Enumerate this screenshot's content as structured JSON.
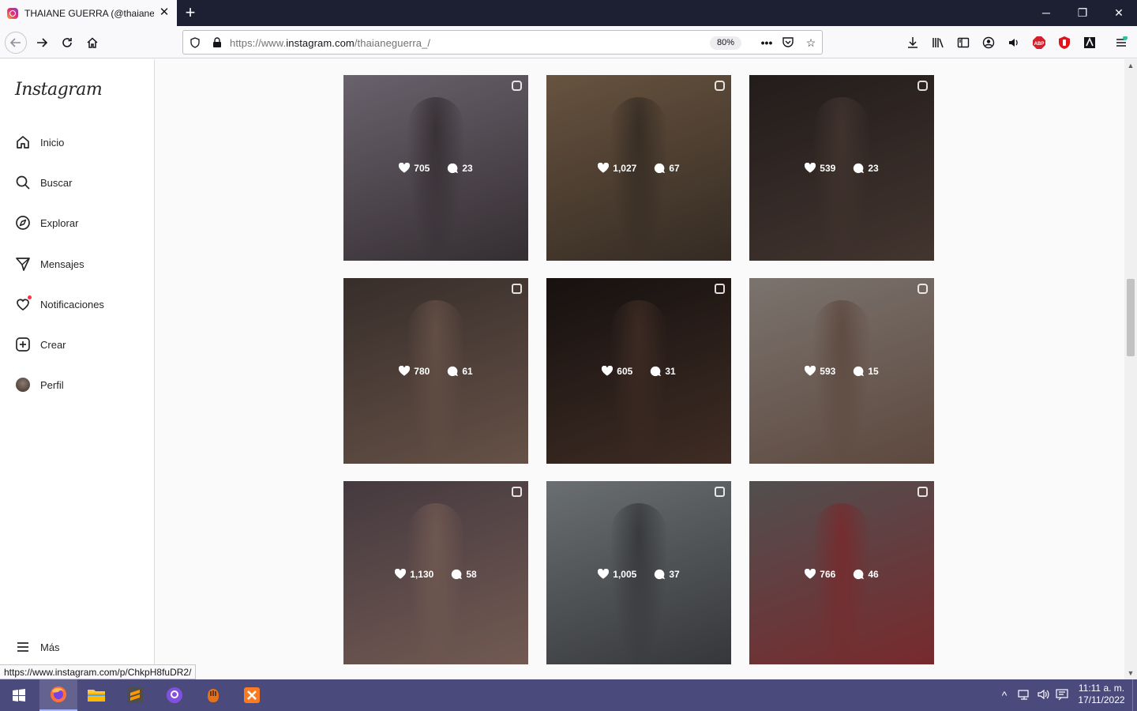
{
  "browser": {
    "tab_title": "THAIANE GUERRA (@thaianeguerra_)",
    "url_prefix": "https://www.",
    "url_domain": "instagram.com",
    "url_path": "/thaianeguerra_/",
    "zoom": "80%",
    "status_link": "https://www.instagram.com/p/ChkpH8fuDR2/"
  },
  "sidebar": {
    "logo": "Instagram",
    "items": [
      {
        "label": "Inicio",
        "icon": "home-icon"
      },
      {
        "label": "Buscar",
        "icon": "search-icon"
      },
      {
        "label": "Explorar",
        "icon": "compass-icon"
      },
      {
        "label": "Mensajes",
        "icon": "send-icon"
      },
      {
        "label": "Notificaciones",
        "icon": "heart-icon"
      },
      {
        "label": "Crear",
        "icon": "create-icon"
      },
      {
        "label": "Perfil",
        "icon": "avatar"
      }
    ],
    "more_label": "Más"
  },
  "posts": [
    {
      "likes": "705",
      "comments": "23",
      "type": "reel",
      "bg": "#8d8390",
      "fg": "#2a2224"
    },
    {
      "likes": "1,027",
      "comments": "67",
      "type": "reel",
      "bg": "#8a6f55",
      "fg": "#2b2420"
    },
    {
      "likes": "539",
      "comments": "23",
      "type": "reel",
      "bg": "#2e2624",
      "fg": "#6b544a"
    },
    {
      "likes": "780",
      "comments": "61",
      "type": "carousel",
      "bg": "#4a3d38",
      "fg": "#a08070"
    },
    {
      "likes": "605",
      "comments": "31",
      "type": "carousel",
      "bg": "#1e1715",
      "fg": "#6a4a3c"
    },
    {
      "likes": "593",
      "comments": "15",
      "type": "reel",
      "bg": "#a59a93",
      "fg": "#6b4a3a"
    },
    {
      "likes": "1,130",
      "comments": "58",
      "type": "carousel",
      "bg": "#5c4d55",
      "fg": "#b28a78"
    },
    {
      "likes": "1,005",
      "comments": "37",
      "type": "carousel",
      "bg": "#8e9498",
      "fg": "#2a2a2e"
    },
    {
      "likes": "766",
      "comments": "46",
      "type": "carousel",
      "bg": "#6d6a6a",
      "fg": "#b5232a"
    }
  ],
  "taskbar": {
    "time": "11:11 a. m.",
    "date": "17/11/2022"
  }
}
